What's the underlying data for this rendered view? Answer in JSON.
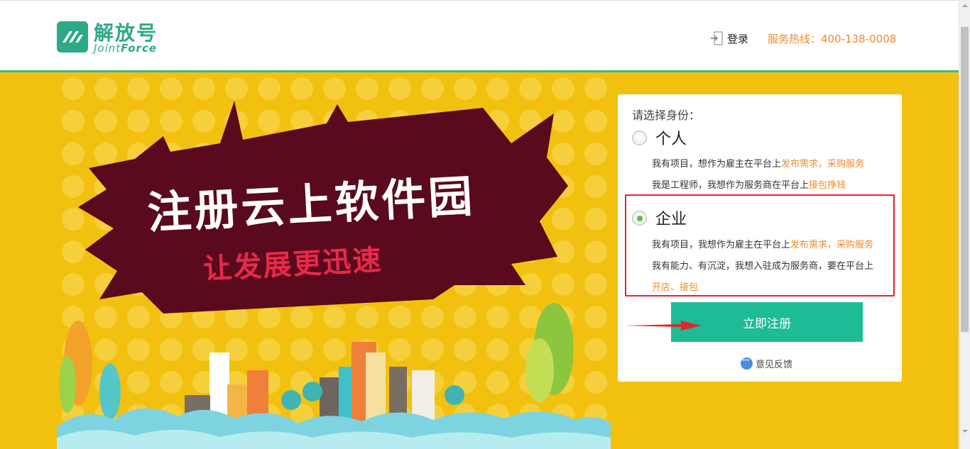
{
  "header": {
    "logo_cn": "解放号",
    "logo_en_light": "Joint",
    "logo_en_bold": "Force",
    "login_label": "登录",
    "hotline": "服务热线：400-138-0008"
  },
  "banner": {
    "title": "注册云上软件园",
    "subtitle": "让发展更迅速"
  },
  "panel": {
    "prompt": "请选择身份：",
    "options": [
      {
        "label": "个人",
        "checked": false,
        "lines": [
          {
            "text": "我有项目，想作为雇主在平台上",
            "highlight": "发布需求，采购服务"
          },
          {
            "text": "我是工程师，我想作为服务商在平台上",
            "highlight": "接包挣钱"
          }
        ]
      },
      {
        "label": "企业",
        "checked": true,
        "lines": [
          {
            "text": "我有项目，我想作为雇主在平台上",
            "highlight": "发布需求，采购服务"
          },
          {
            "text": "我有能力、有沉淀，我想入驻成为服务商，要在平台上",
            "highlight": ""
          },
          {
            "text": "",
            "highlight": "开店、接包"
          }
        ]
      }
    ],
    "register_label": "立即注册",
    "feedback_label": "意见反馈"
  },
  "colors": {
    "brand_green": "#2ea988",
    "button_green": "#1dbb96",
    "banner_yellow": "#f2c10f",
    "highlight_orange": "#f08a2a",
    "annotation_red": "#e8222a"
  }
}
